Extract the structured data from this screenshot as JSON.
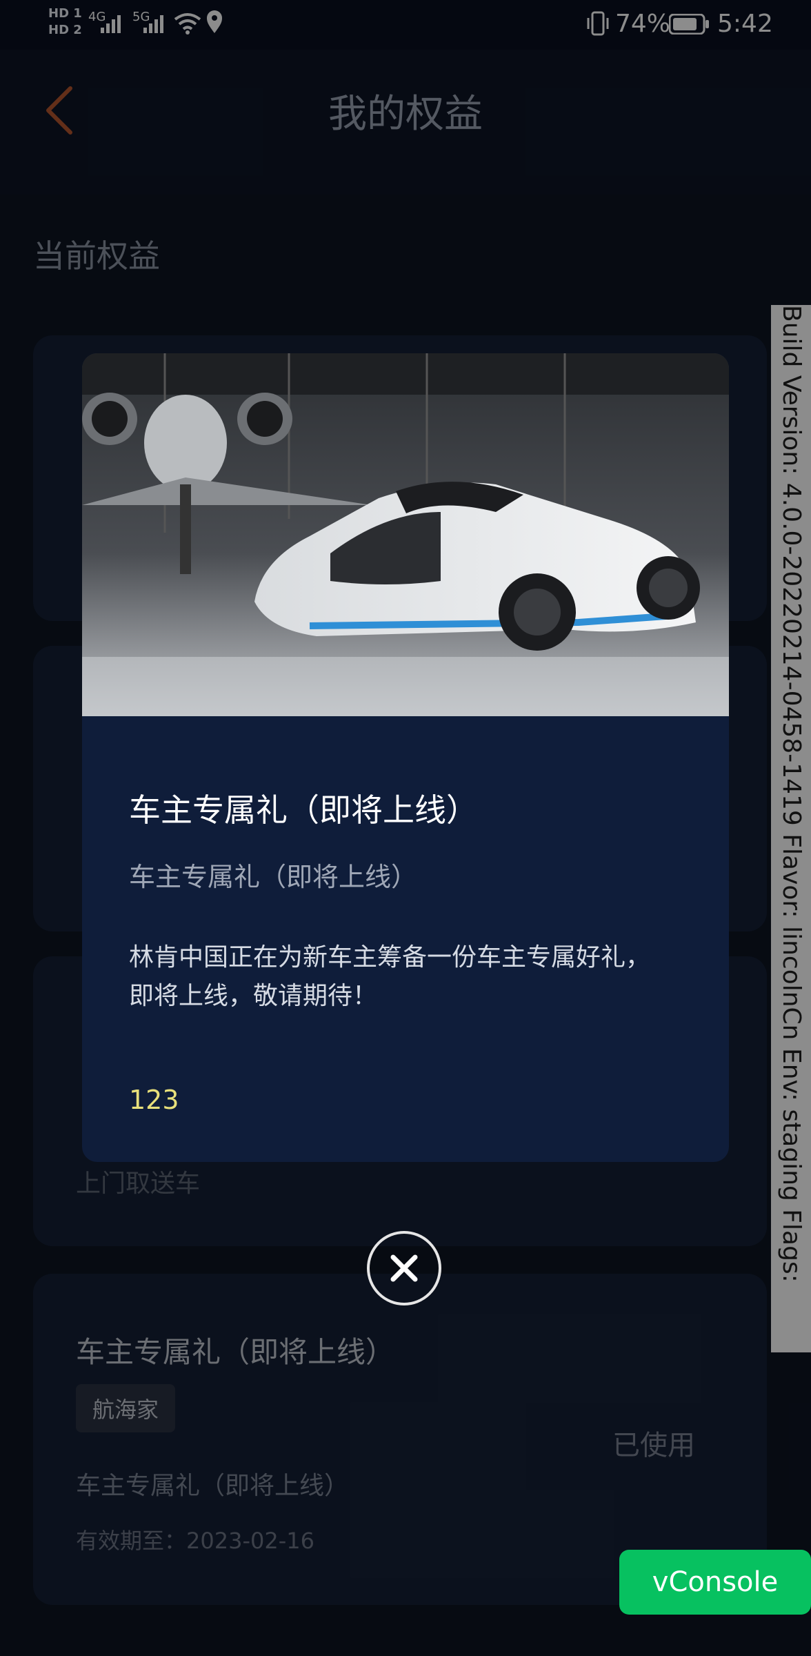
{
  "status_bar": {
    "sim1": "HD 1",
    "sim2": "HD 2",
    "net1": "4G",
    "net2": "5G",
    "battery": "74%",
    "time": "5:42",
    "icons": [
      "signal-icon",
      "wifi-icon",
      "location-icon",
      "vibrate-icon",
      "battery-icon"
    ]
  },
  "header": {
    "title": "我的权益",
    "back_icon": "chevron-left-icon"
  },
  "section_title": "当前权益",
  "cards": [
    {
      "title": "车主专属礼（即将上线）",
      "tag": "航海家",
      "description": "车主专属礼（即将上线）",
      "validity": "有效期至：2023-02-16",
      "status": "已使用"
    }
  ],
  "partial_texts": {
    "pickup": "上门取送车"
  },
  "modal": {
    "title": "车主专属礼（即将上线）",
    "subtitle": "车主专属礼（即将上线）",
    "body": "林肯中国正在为新车主筹备一份车主专属好礼，\n即将上线，敬请期待！",
    "code": "123",
    "close_icon": "close-icon"
  },
  "debug": {
    "build_info": "Build Version: 4.0.0-20220214-0458-1419 Flavor: lincolnCn Env: staging Flags:",
    "vconsole_label": "vConsole"
  },
  "colors": {
    "background": "#0d1422",
    "modal_bg": "#0f1d3a",
    "code_yellow": "#e8e07b",
    "vconsole_green": "#07c160",
    "back_arrow": "#b5562f"
  }
}
